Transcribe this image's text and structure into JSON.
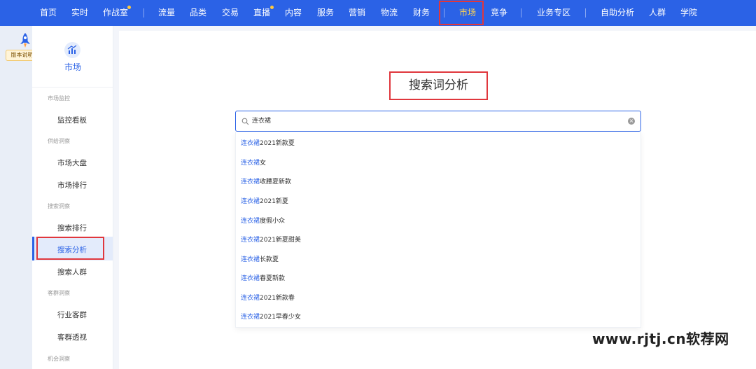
{
  "nav": {
    "items": [
      "首页",
      "实时",
      "作战室",
      "流量",
      "品类",
      "交易",
      "直播",
      "内容",
      "服务",
      "营销",
      "物流",
      "财务",
      "市场",
      "竞争",
      "业务专区",
      "自助分析",
      "人群",
      "学院"
    ],
    "active": "市场",
    "colors": {
      "bar": "#2b62e6",
      "active_text": "#ffd34f",
      "highlight_box": "#e0373d"
    }
  },
  "rail": {
    "version_tag": "版本说明",
    "icon": "rocket-icon"
  },
  "sidebar": {
    "header_label": "市场",
    "header_icon": "market-chart-icon",
    "groups": [
      {
        "title": "市场监控",
        "items": [
          "监控看板"
        ]
      },
      {
        "title": "供给洞察",
        "items": [
          "市场大盘",
          "市场排行"
        ]
      },
      {
        "title": "搜索洞察",
        "items": [
          "搜索排行",
          "搜索分析",
          "搜索人群"
        ]
      },
      {
        "title": "客群洞察",
        "items": [
          "行业客群",
          "客群透视"
        ]
      },
      {
        "title": "机会洞察",
        "items": []
      }
    ],
    "active_item": "搜索分析"
  },
  "main": {
    "title": "搜索词分析",
    "search": {
      "value": "连衣裙",
      "icon": "search-icon",
      "clear_icon": "clear-icon"
    },
    "suggestions": [
      {
        "kw": "连衣裙",
        "rest": "2021新款夏"
      },
      {
        "kw": "连衣裙",
        "rest": "女"
      },
      {
        "kw": "连衣裙",
        "rest": "收腰夏新款"
      },
      {
        "kw": "连衣裙",
        "rest": "2021新夏"
      },
      {
        "kw": "连衣裙",
        "rest": "度假小众"
      },
      {
        "kw": "连衣裙",
        "rest": "2021新夏甜美"
      },
      {
        "kw": "连衣裙",
        "rest": "长款夏"
      },
      {
        "kw": "连衣裙",
        "rest": "春夏新款"
      },
      {
        "kw": "连衣裙",
        "rest": "2021新款春"
      },
      {
        "kw": "连衣裙",
        "rest": "2021早春少女"
      }
    ]
  },
  "watermark": "www.rjtj.cn软荐网"
}
